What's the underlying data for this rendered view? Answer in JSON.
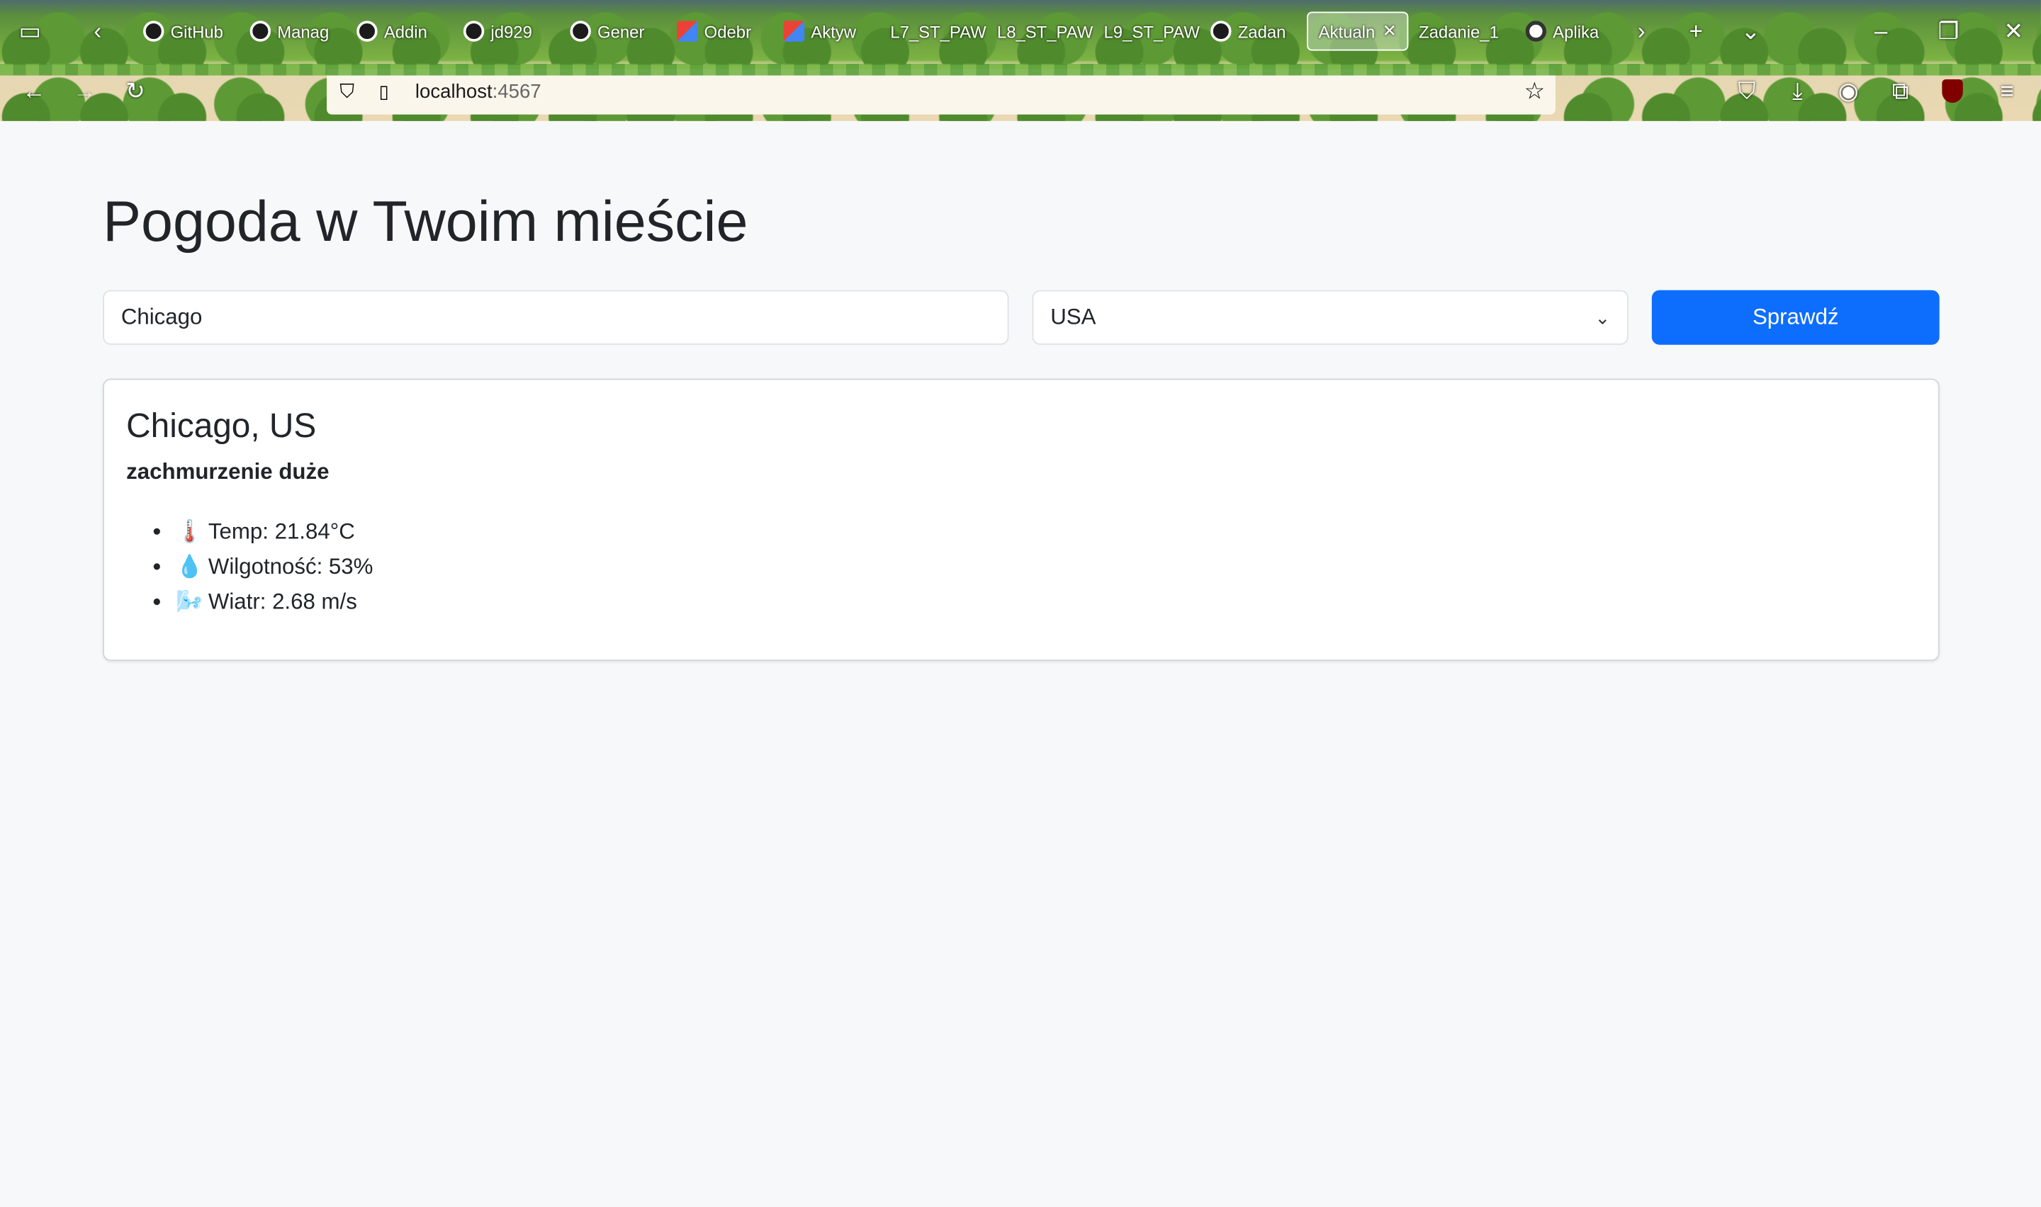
{
  "browser": {
    "tabs": [
      {
        "label": "GitHub",
        "icon": "github-icon"
      },
      {
        "label": "Manag",
        "icon": "github-icon"
      },
      {
        "label": "Addin",
        "icon": "github-icon"
      },
      {
        "label": "jd929",
        "icon": "github-icon"
      },
      {
        "label": "Gener",
        "icon": "github-icon"
      },
      {
        "label": "Odebr",
        "icon": "gmail-icon"
      },
      {
        "label": "Aktyw",
        "icon": "gmail-icon"
      },
      {
        "label": "L7_ST_PAW",
        "icon": ""
      },
      {
        "label": "L8_ST_PAW",
        "icon": ""
      },
      {
        "label": "L9_ST_PAW",
        "icon": ""
      },
      {
        "label": "Zadan",
        "icon": "github-icon"
      },
      {
        "label": "Aktualn",
        "icon": "",
        "active": true
      },
      {
        "label": "Zadanie_1",
        "icon": ""
      },
      {
        "label": "Aplika",
        "icon": "openai-icon"
      }
    ],
    "url_host": "localhost",
    "url_port": ":4567"
  },
  "page": {
    "title": "Pogoda w Twoim mieście",
    "city_value": "Chicago",
    "country_value": "USA",
    "submit_label": "Sprawdź"
  },
  "result": {
    "location": "Chicago, US",
    "description": "zachmurzenie duże",
    "items": [
      {
        "icon": "thermometer-icon",
        "emoji": "🌡️",
        "text": "Temp: 21.84°C"
      },
      {
        "icon": "droplet-icon",
        "emoji": "💧",
        "text": "Wilgotność: 53%"
      },
      {
        "icon": "wind-icon",
        "emoji": "🌬️",
        "text": "Wiatr: 2.68 m/s"
      }
    ]
  }
}
